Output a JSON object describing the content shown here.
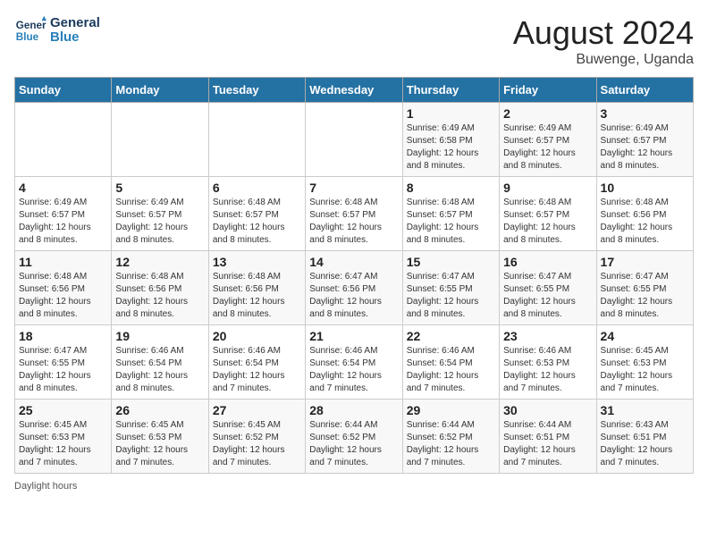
{
  "header": {
    "logo_line1": "General",
    "logo_line2": "Blue",
    "month_year": "August 2024",
    "location": "Buwenge, Uganda"
  },
  "days_of_week": [
    "Sunday",
    "Monday",
    "Tuesday",
    "Wednesday",
    "Thursday",
    "Friday",
    "Saturday"
  ],
  "weeks": [
    [
      {
        "day": "",
        "info": ""
      },
      {
        "day": "",
        "info": ""
      },
      {
        "day": "",
        "info": ""
      },
      {
        "day": "",
        "info": ""
      },
      {
        "day": "1",
        "info": "Sunrise: 6:49 AM\nSunset: 6:58 PM\nDaylight: 12 hours and 8 minutes."
      },
      {
        "day": "2",
        "info": "Sunrise: 6:49 AM\nSunset: 6:57 PM\nDaylight: 12 hours and 8 minutes."
      },
      {
        "day": "3",
        "info": "Sunrise: 6:49 AM\nSunset: 6:57 PM\nDaylight: 12 hours and 8 minutes."
      }
    ],
    [
      {
        "day": "4",
        "info": "Sunrise: 6:49 AM\nSunset: 6:57 PM\nDaylight: 12 hours and 8 minutes."
      },
      {
        "day": "5",
        "info": "Sunrise: 6:49 AM\nSunset: 6:57 PM\nDaylight: 12 hours and 8 minutes."
      },
      {
        "day": "6",
        "info": "Sunrise: 6:48 AM\nSunset: 6:57 PM\nDaylight: 12 hours and 8 minutes."
      },
      {
        "day": "7",
        "info": "Sunrise: 6:48 AM\nSunset: 6:57 PM\nDaylight: 12 hours and 8 minutes."
      },
      {
        "day": "8",
        "info": "Sunrise: 6:48 AM\nSunset: 6:57 PM\nDaylight: 12 hours and 8 minutes."
      },
      {
        "day": "9",
        "info": "Sunrise: 6:48 AM\nSunset: 6:57 PM\nDaylight: 12 hours and 8 minutes."
      },
      {
        "day": "10",
        "info": "Sunrise: 6:48 AM\nSunset: 6:56 PM\nDaylight: 12 hours and 8 minutes."
      }
    ],
    [
      {
        "day": "11",
        "info": "Sunrise: 6:48 AM\nSunset: 6:56 PM\nDaylight: 12 hours and 8 minutes."
      },
      {
        "day": "12",
        "info": "Sunrise: 6:48 AM\nSunset: 6:56 PM\nDaylight: 12 hours and 8 minutes."
      },
      {
        "day": "13",
        "info": "Sunrise: 6:48 AM\nSunset: 6:56 PM\nDaylight: 12 hours and 8 minutes."
      },
      {
        "day": "14",
        "info": "Sunrise: 6:47 AM\nSunset: 6:56 PM\nDaylight: 12 hours and 8 minutes."
      },
      {
        "day": "15",
        "info": "Sunrise: 6:47 AM\nSunset: 6:55 PM\nDaylight: 12 hours and 8 minutes."
      },
      {
        "day": "16",
        "info": "Sunrise: 6:47 AM\nSunset: 6:55 PM\nDaylight: 12 hours and 8 minutes."
      },
      {
        "day": "17",
        "info": "Sunrise: 6:47 AM\nSunset: 6:55 PM\nDaylight: 12 hours and 8 minutes."
      }
    ],
    [
      {
        "day": "18",
        "info": "Sunrise: 6:47 AM\nSunset: 6:55 PM\nDaylight: 12 hours and 8 minutes."
      },
      {
        "day": "19",
        "info": "Sunrise: 6:46 AM\nSunset: 6:54 PM\nDaylight: 12 hours and 8 minutes."
      },
      {
        "day": "20",
        "info": "Sunrise: 6:46 AM\nSunset: 6:54 PM\nDaylight: 12 hours and 7 minutes."
      },
      {
        "day": "21",
        "info": "Sunrise: 6:46 AM\nSunset: 6:54 PM\nDaylight: 12 hours and 7 minutes."
      },
      {
        "day": "22",
        "info": "Sunrise: 6:46 AM\nSunset: 6:54 PM\nDaylight: 12 hours and 7 minutes."
      },
      {
        "day": "23",
        "info": "Sunrise: 6:46 AM\nSunset: 6:53 PM\nDaylight: 12 hours and 7 minutes."
      },
      {
        "day": "24",
        "info": "Sunrise: 6:45 AM\nSunset: 6:53 PM\nDaylight: 12 hours and 7 minutes."
      }
    ],
    [
      {
        "day": "25",
        "info": "Sunrise: 6:45 AM\nSunset: 6:53 PM\nDaylight: 12 hours and 7 minutes."
      },
      {
        "day": "26",
        "info": "Sunrise: 6:45 AM\nSunset: 6:53 PM\nDaylight: 12 hours and 7 minutes."
      },
      {
        "day": "27",
        "info": "Sunrise: 6:45 AM\nSunset: 6:52 PM\nDaylight: 12 hours and 7 minutes."
      },
      {
        "day": "28",
        "info": "Sunrise: 6:44 AM\nSunset: 6:52 PM\nDaylight: 12 hours and 7 minutes."
      },
      {
        "day": "29",
        "info": "Sunrise: 6:44 AM\nSunset: 6:52 PM\nDaylight: 12 hours and 7 minutes."
      },
      {
        "day": "30",
        "info": "Sunrise: 6:44 AM\nSunset: 6:51 PM\nDaylight: 12 hours and 7 minutes."
      },
      {
        "day": "31",
        "info": "Sunrise: 6:43 AM\nSunset: 6:51 PM\nDaylight: 12 hours and 7 minutes."
      }
    ]
  ],
  "footer": {
    "note": "Daylight hours"
  }
}
